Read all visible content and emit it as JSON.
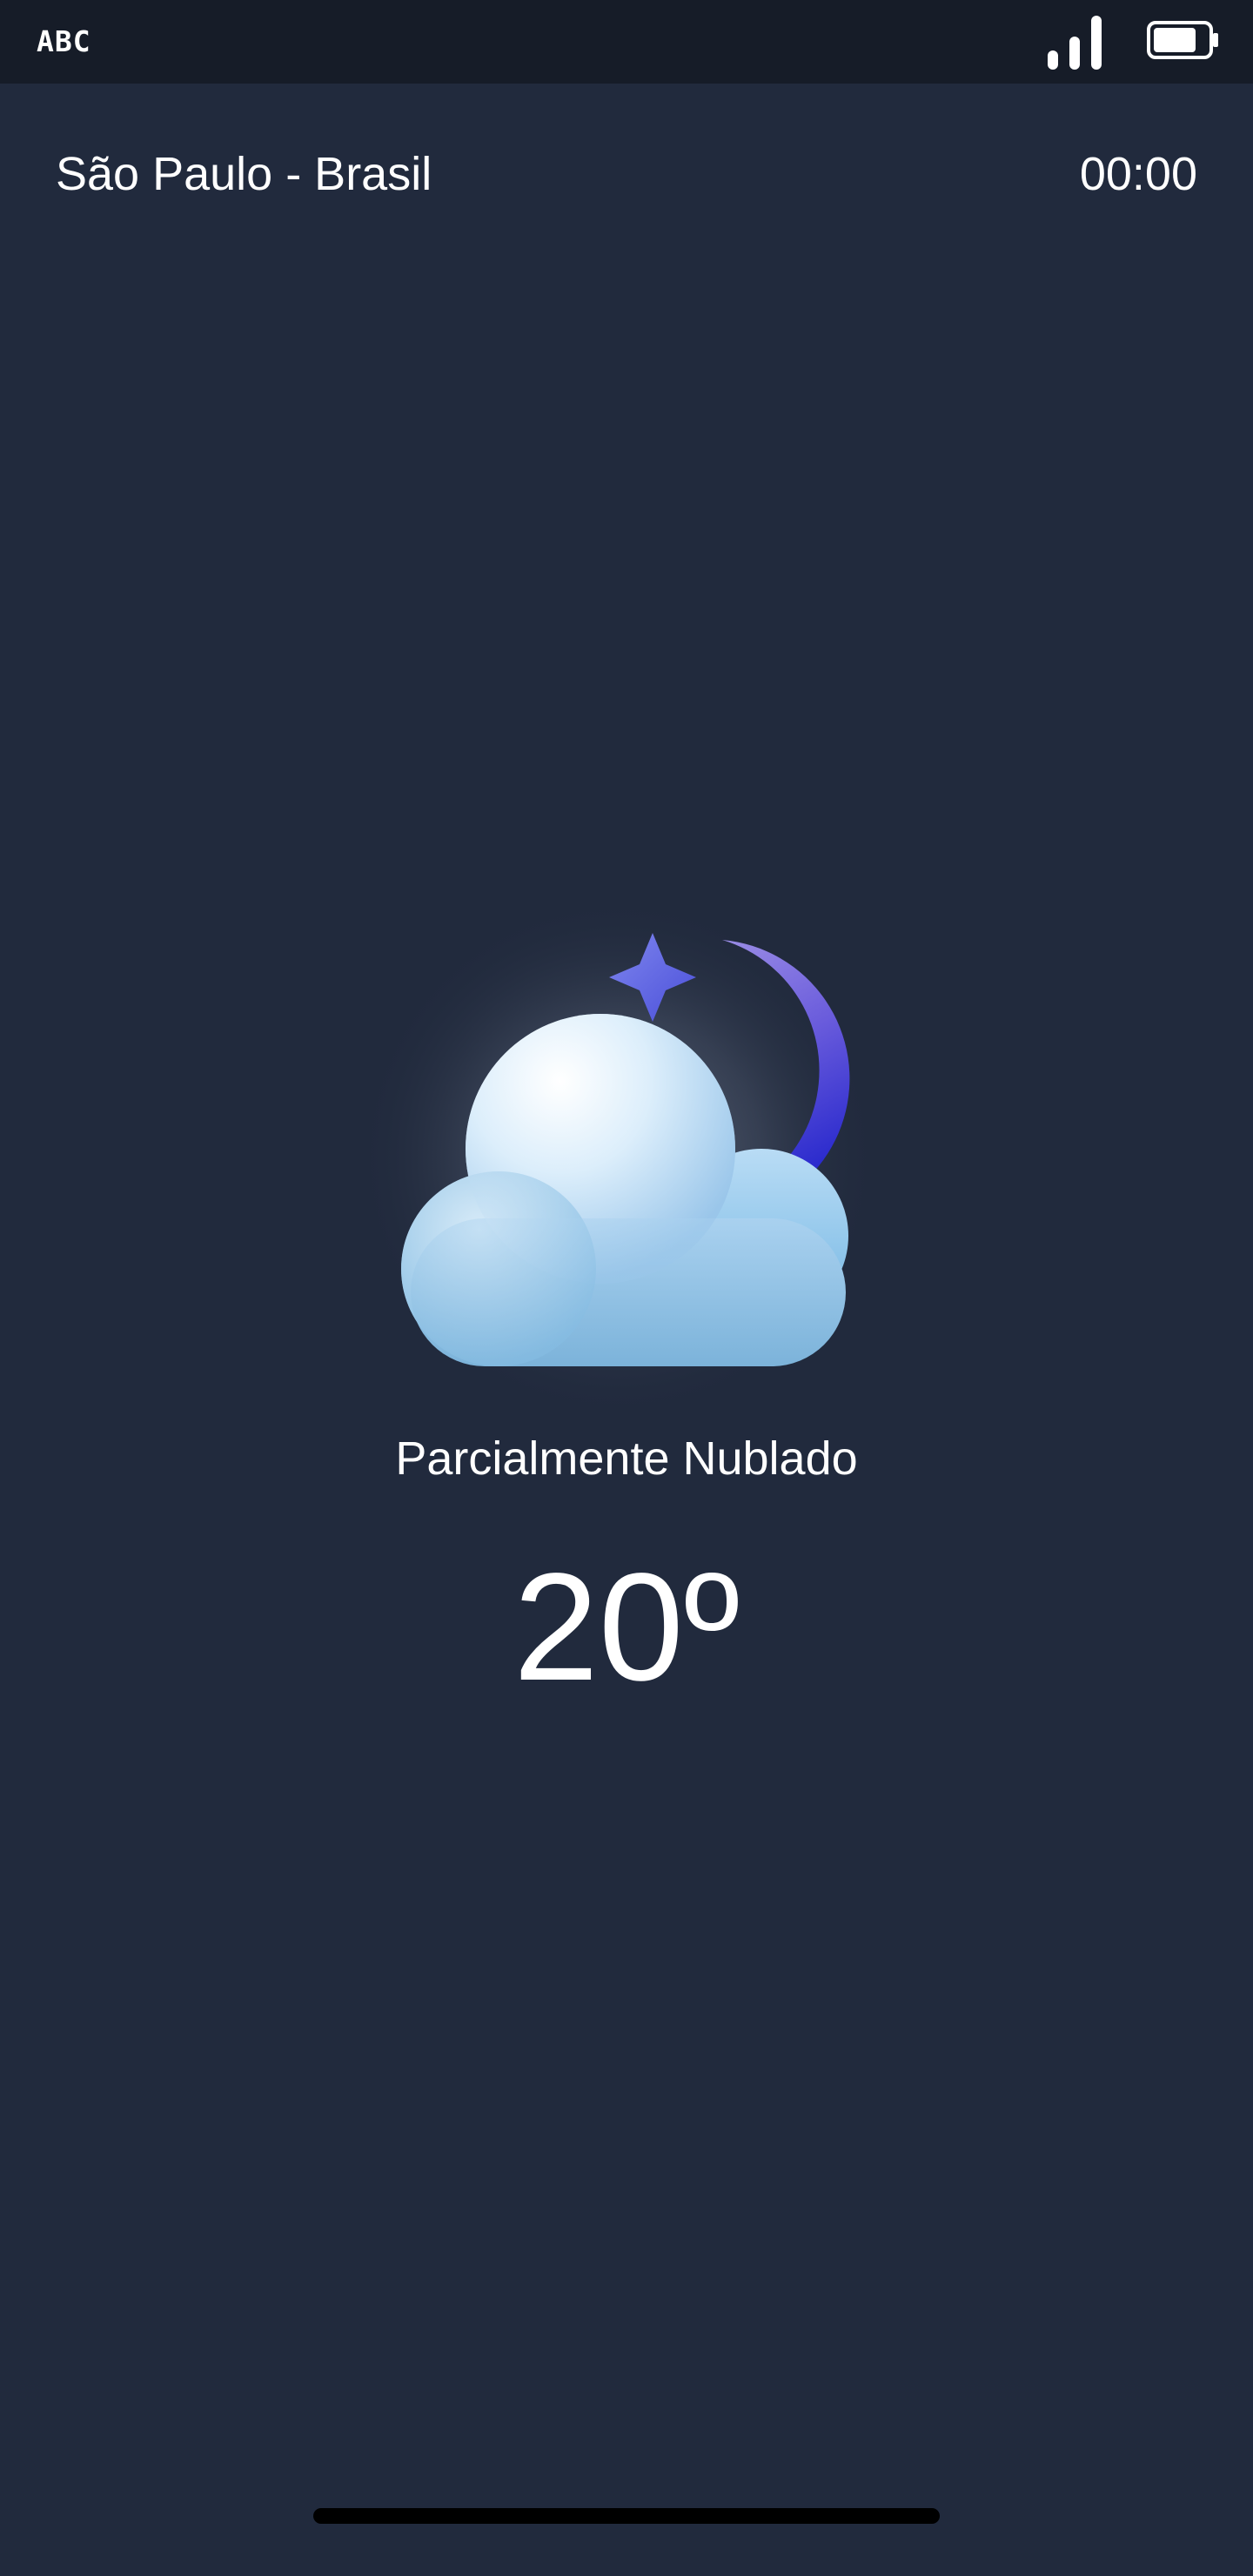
{
  "status_bar": {
    "carrier": "ABC",
    "signal_icon": "signal-bars-icon",
    "battery_icon": "battery-icon"
  },
  "header": {
    "location": "São Paulo - Brasil",
    "time": "00:00"
  },
  "weather": {
    "icon": "partly-cloudy-night-icon",
    "condition": "Parcialmente Nublado",
    "temperature": "20º"
  },
  "colors": {
    "background": "#212a3d",
    "status_bar": "#161c28",
    "text": "#ffffff",
    "moon_accent": "#5a4be0"
  }
}
